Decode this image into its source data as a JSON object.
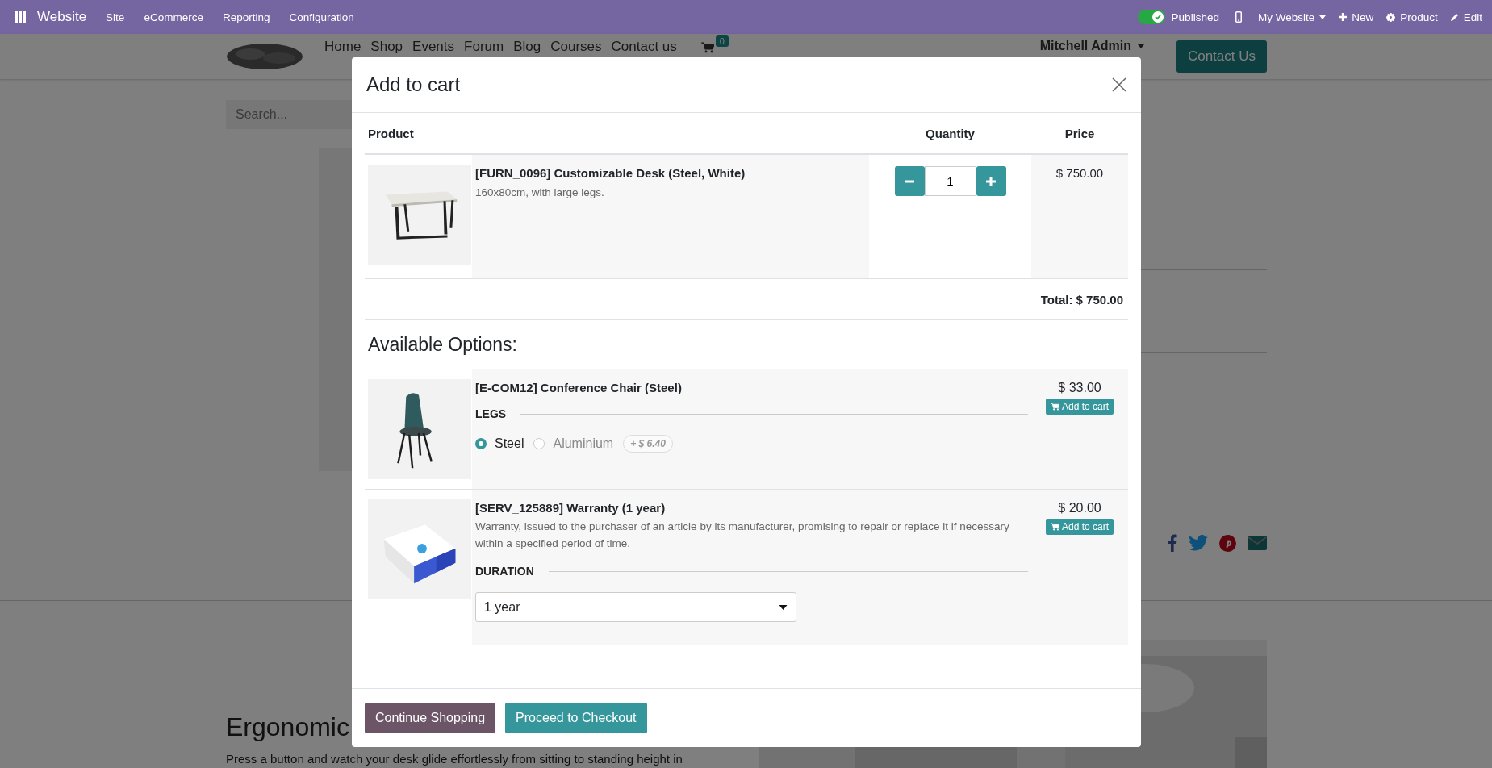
{
  "top_bar": {
    "app": "Website",
    "menu": [
      "Site",
      "eCommerce",
      "Reporting",
      "Configuration"
    ],
    "published": {
      "label": "Published",
      "on": true
    },
    "website": "My Website",
    "actions": [
      {
        "kind": "new",
        "label": "New"
      },
      {
        "kind": "product",
        "label": "Product"
      },
      {
        "kind": "edit",
        "label": "Edit"
      }
    ]
  },
  "site_header": {
    "nav": [
      "Home",
      "Shop",
      "Events",
      "Forum",
      "Blog",
      "Courses",
      "Contact us"
    ],
    "cart_count": "0",
    "user": "Mitchell Admin",
    "cta": "Contact Us"
  },
  "page": {
    "search_placeholder": "Search...",
    "heading": "Ergonomic",
    "text": "Press a button and watch your desk glide effortlessly from sitting to standing height in"
  },
  "modal": {
    "title": "Add to cart",
    "columns": [
      "Product",
      "Quantity",
      "Price"
    ],
    "product": {
      "name": "[FURN_0096] Customizable Desk (Steel, White)",
      "description": "160x80cm, with large legs.",
      "quantity": "1",
      "price": "$ 750.00"
    },
    "total": "Total: $ 750.00",
    "options_title": "Available Options:",
    "options": [
      {
        "name": "[E-COM12] Conference Chair (Steel)",
        "price": "$ 33.00",
        "add_label": "Add to cart",
        "attribute": {
          "kind": "radio",
          "label": "LEGS",
          "choices": [
            {
              "label": "Steel",
              "selected": true
            },
            {
              "label": "Aluminium",
              "selected": false,
              "extra": "+ $ 6.40"
            }
          ]
        }
      },
      {
        "name": "[SERV_125889] Warranty (1 year)",
        "description": "Warranty, issued to the purchaser of an article by its manufacturer, promising to repair or replace it if necessary within a specified period of time.",
        "price": "$ 20.00",
        "add_label": "Add to cart",
        "attribute": {
          "kind": "select",
          "label": "DURATION",
          "value": "1 year"
        }
      }
    ],
    "buttons": [
      {
        "kind": "secondary",
        "label": "Continue Shopping"
      },
      {
        "kind": "primary",
        "label": "Proceed to Checkout"
      }
    ]
  }
}
